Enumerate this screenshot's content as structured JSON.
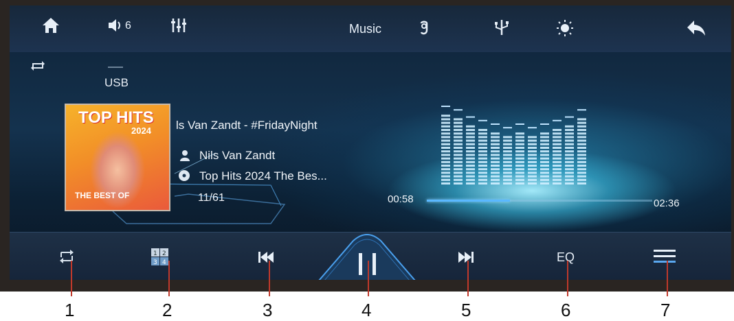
{
  "topbar": {
    "volume_level": "6",
    "title": "Music"
  },
  "source": {
    "label": "USB"
  },
  "album_art": {
    "line1": "TOP HITS",
    "line2": "2024",
    "line3": "THE BEST OF"
  },
  "track": {
    "title": "ls Van Zandt - #FridayNight",
    "artist": "Nils Van Zandt",
    "album": "Top Hits 2024 The Bes...",
    "position": "11/61"
  },
  "progress": {
    "elapsed": "00:58",
    "total": "02:36",
    "fraction": 0.37
  },
  "controls": {
    "eq_label": "EQ"
  },
  "callouts": [
    "1",
    "2",
    "3",
    "4",
    "5",
    "6",
    "7"
  ],
  "equalizer_levels": [
    0.95,
    0.9,
    0.85,
    0.8,
    0.75,
    0.7,
    0.72,
    0.7,
    0.75,
    0.8,
    0.85,
    0.9
  ],
  "colors": {
    "accent": "#5ab8ff",
    "callout_line": "#c0392b"
  }
}
